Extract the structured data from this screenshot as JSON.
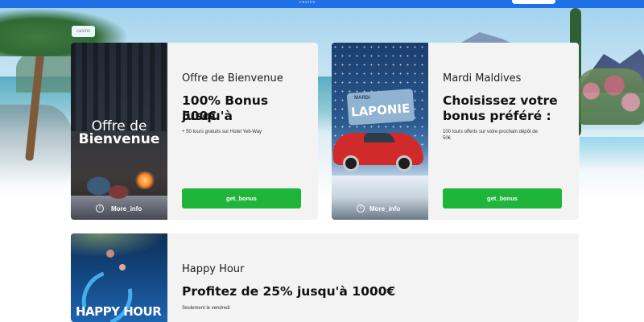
{
  "topbar": {
    "label": "casino"
  },
  "breadcrumb": {
    "label": "casino"
  },
  "cards": [
    {
      "image_text_line1": "Offre de",
      "image_text_line2": "Bienvenue",
      "subtitle": "Offre de Bienvenue",
      "title_line1": "100% Bonus jusqu'à",
      "title_line2": "500€",
      "description": "+ 50 tours gratuits sur Hotel Yeti-Way",
      "button_label": "get_bonus",
      "more_info_label": "More_info"
    },
    {
      "image_sign_small": "MARDI",
      "image_sign_large": "LAPONIE",
      "subtitle": "Mardi Maldives",
      "title_line1": "Choisissez votre",
      "title_line2": "bonus préféré :",
      "description_line1": "100 tours offerts sur votre prochain dépôt de",
      "description_line2": "50€",
      "button_label": "get_bonus",
      "more_info_label": "More_info"
    },
    {
      "image_logo_text": "HAPPY HOUR",
      "subtitle": "Happy Hour",
      "title_line1": "Profitez de 25% jusqu'à 1000€",
      "description": "Seulement le vendredi"
    }
  ],
  "colors": {
    "topbar": "#1f6fe6",
    "card_bg": "#f3f3f3",
    "button": "#1fb53a"
  },
  "icons": [
    "info-icon"
  ]
}
